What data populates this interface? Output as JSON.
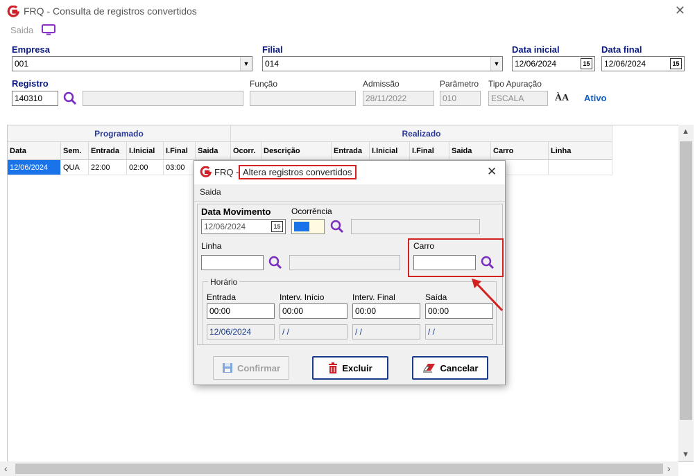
{
  "window": {
    "title": "FRQ - Consulta de registros convertidos",
    "close_symbol": "✕"
  },
  "menu": {
    "saida": "Saida"
  },
  "form": {
    "empresa_label": "Empresa",
    "empresa_value": "001",
    "filial_label": "Filial",
    "filial_value": "014",
    "data_inicial_label": "Data inicial",
    "data_inicial_value": "12/06/2024",
    "data_final_label": "Data final",
    "data_final_value": "12/06/2024",
    "registro_label": "Registro",
    "registro_value": "140310",
    "registro_name": "",
    "funcao_label": "Função",
    "funcao_value": "",
    "admissao_label": "Admissão",
    "admissao_value": "28/11/2022",
    "parametro_label": "Parâmetro",
    "parametro_value": "010",
    "tipo_apuracao_label": "Tipo Apuração",
    "tipo_apuracao_value": "ESCALA",
    "status": "Ativo"
  },
  "grid": {
    "group_programado": "Programado",
    "group_realizado": "Realizado",
    "columns": [
      "Data",
      "Sem.",
      "Entrada",
      "I.Inicial",
      "I.Final",
      "Saida",
      "Ocorr.",
      "Descrição",
      "Entrada",
      "I.Inicial",
      "I.Final",
      "Saida",
      "Carro",
      "Linha"
    ],
    "row": [
      "12/06/2024",
      "QUA",
      "22:00",
      "02:00",
      "03:00"
    ]
  },
  "dialog": {
    "title_prefix": "FRQ -",
    "title_rest": "Altera registros convertidos",
    "close_symbol": "✕",
    "menu": "Saida",
    "data_movimento_label": "Data Movimento",
    "data_movimento_value": "12/06/2024",
    "ocorrencia_label": "Ocorrência",
    "linha_label": "Linha",
    "carro_label": "Carro",
    "horario_label": "Horário",
    "entrada_label": "Entrada",
    "entrada_value": "00:00",
    "entrada_date": "12/06/2024",
    "interv_inicio_label": "Interv. Início",
    "interv_inicio_value": "00:00",
    "interv_inicio_date": "/ /",
    "interv_final_label": "Interv. Final",
    "interv_final_value": "00:00",
    "interv_final_date": "/ /",
    "saida_label": "Saída",
    "saida_value": "00:00",
    "saida_date": "/ /",
    "btn_confirmar": "Confirmar",
    "btn_excluir": "Excluir",
    "btn_cancelar": "Cancelar"
  },
  "colors": {
    "label_blue": "#0a1a80",
    "accent": "#1a73e8",
    "highlight_red": "#d32020",
    "magnifier": "#7b2fbf"
  }
}
